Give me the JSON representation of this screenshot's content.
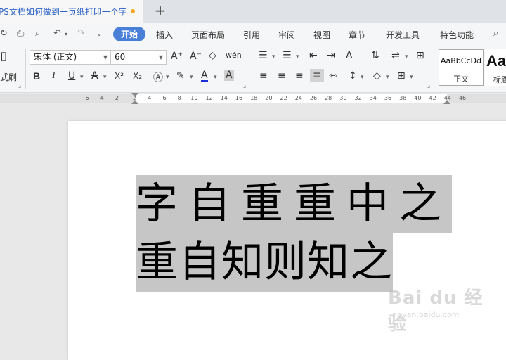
{
  "tabbar": {
    "doc_title": "PS文档如何做到一页纸打印一个字",
    "new_tab_icon": "plus-icon",
    "modified_dot_color": "#f5a623"
  },
  "menubar": {
    "items": [
      "开始",
      "插入",
      "页面布局",
      "引用",
      "审阅",
      "视图",
      "章节",
      "开发工具",
      "特色功能"
    ],
    "active_index": 0,
    "active_color": "#4a7fd8"
  },
  "ribbon": {
    "format_painter_label": "式刷",
    "font_name": "宋体 (正文)",
    "font_size": "60",
    "bold_label": "B",
    "italic_label": "I",
    "underline_label": "U",
    "strike_label": "A",
    "superscript_label": "X²",
    "subscript_label": "X₂",
    "font_color_label": "A",
    "highlight_label": "A",
    "grow_font_label": "A⁺",
    "shrink_font_label": "A⁻",
    "pinyin_label": "wén",
    "style_sample": "AaBbCcDd",
    "style_name": "正文",
    "style2_sample": "AaI",
    "style2_name": "标题"
  },
  "ruler": {
    "ticks": [
      "6",
      "4",
      "2",
      "2",
      "4",
      "6",
      "8",
      "10",
      "12",
      "14",
      "16",
      "18",
      "20",
      "22",
      "24",
      "26",
      "28",
      "30",
      "32",
      "34",
      "36",
      "38",
      "40",
      "42",
      "44",
      "46"
    ]
  },
  "document": {
    "line1": "字自重重中之",
    "line2": "重自知则知之",
    "selection_color": "#c6c6c6"
  },
  "watermark": {
    "brand": "Bai du 经验",
    "url": "jingyan.baidu.com"
  }
}
